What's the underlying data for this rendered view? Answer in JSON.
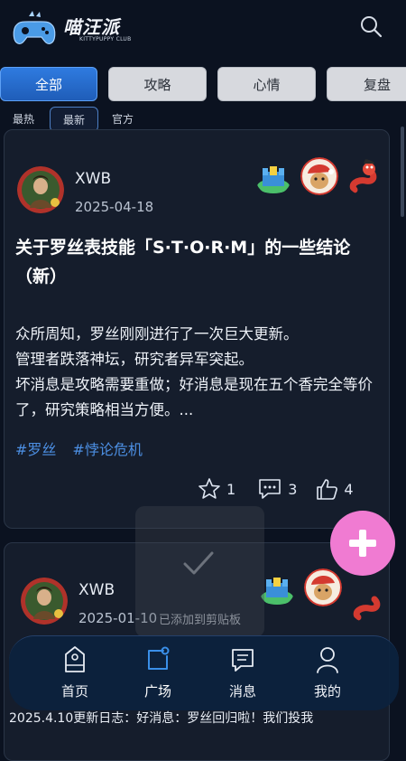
{
  "header": {
    "logo_title": "喵汪派",
    "logo_subtitle": "KITTYPUPPY CLUB",
    "search_icon": "search-icon"
  },
  "category_tabs": [
    {
      "label": "全部",
      "active": true
    },
    {
      "label": "攻略",
      "active": false
    },
    {
      "label": "心情",
      "active": false
    },
    {
      "label": "复盘",
      "active": false
    }
  ],
  "sort_tabs": [
    {
      "label": "最热",
      "active": false
    },
    {
      "label": "最新",
      "active": true
    },
    {
      "label": "官方",
      "active": false
    }
  ],
  "posts": [
    {
      "author": "XWB",
      "date": "2025-04-18",
      "title": "关于罗丝表技能「S·T·O·R·M」的一些结论（新）",
      "body_lines": [
        "众所周知，罗丝刚刚进行了一次巨大更新。",
        "管理者跌落神坛，研究者异军突起。",
        "坏消息是攻略需要重做；好消息是现在五个香完全等价了，研究策略相当方便。..."
      ],
      "tags": [
        "#罗丝",
        "#悖论危机"
      ],
      "likes": "1",
      "comments": "3",
      "thumbs": "4"
    },
    {
      "author": "XWB",
      "date": "2025-01-10"
    }
  ],
  "toast": {
    "text": "已添加到剪贴板"
  },
  "bottom_nav": [
    {
      "label": "首页",
      "icon": "home-icon",
      "active": false
    },
    {
      "label": "广场",
      "icon": "square-icon",
      "active": true
    },
    {
      "label": "消息",
      "icon": "message-icon",
      "active": false
    },
    {
      "label": "我的",
      "icon": "profile-icon",
      "active": false
    }
  ],
  "under_nav_text": "2025.4.10更新日志：好消息：罗丝回归啦！我们投我",
  "colors": {
    "background": "#0b1220",
    "accent": "#2f7be0",
    "tag": "#4c8fe3",
    "fab": "#f07bd2"
  }
}
